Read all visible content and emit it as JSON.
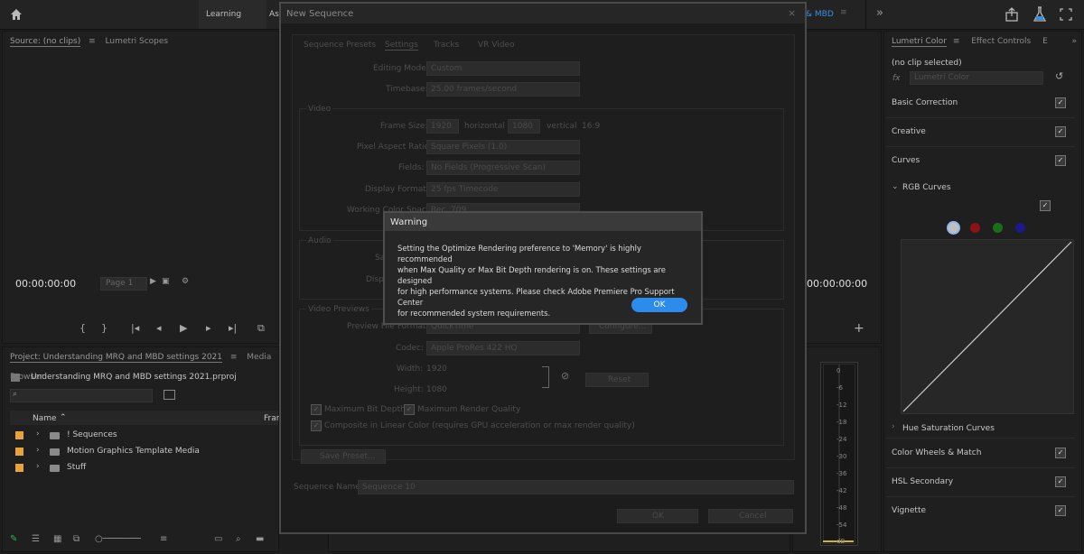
{
  "topbar": {
    "learning": "Learning",
    "assembly_partial": "Ass",
    "workspace_partial": "& MBD",
    "more": "»"
  },
  "source_panel": {
    "tab_source": "Source: (no clips)",
    "tab_lumetri_scopes": "Lumetri Scopes",
    "timecode": "00:00:00:00",
    "page": "Page 1"
  },
  "program_panel": {
    "timecode": "00:00:00:00"
  },
  "project_panel": {
    "tab_project": "Project: Understanding MRQ and MBD settings 2021",
    "tab_media_browser": "Media Browser",
    "project_file": "Understanding MRQ and MBD settings 2021.prproj",
    "col_name": "Name",
    "col_frame_partial": "Fran",
    "items": [
      {
        "label": "! Sequences"
      },
      {
        "label": "Motion Graphics Template Media"
      },
      {
        "label": "Stuff"
      }
    ]
  },
  "lumetri": {
    "tab_lumetri": "Lumetri Color",
    "tab_effect_controls": "Effect Controls",
    "tab_more": "E",
    "no_clip": "(no clip selected)",
    "fx": "fx",
    "effect": "Lumetri Color",
    "sections": {
      "basic": "Basic Correction",
      "creative": "Creative",
      "curves": "Curves",
      "rgb_curves": "RGB Curves",
      "hue_sat": "Hue Saturation Curves",
      "wheels": "Color Wheels & Match",
      "hsl": "HSL Secondary",
      "vignette": "Vignette"
    },
    "curve_colors": [
      "#bfbfbf",
      "#8a1414",
      "#1a6e1a",
      "#1a1a8a"
    ]
  },
  "meter": {
    "ticks": [
      "0",
      "-6",
      "-12",
      "-18",
      "-24",
      "-30",
      "-36",
      "-42",
      "-48",
      "-54",
      "dB"
    ]
  },
  "new_sequence": {
    "title": "New Sequence",
    "close": "×",
    "tabs": [
      "Sequence Presets",
      "Settings",
      "Tracks",
      "VR Video"
    ],
    "editing_mode_label": "Editing Mode:",
    "editing_mode_value": "Custom",
    "timebase_label": "Timebase:",
    "timebase_value": "25.00  frames/second",
    "video_group": "Video",
    "frame_size_label": "Frame Size:",
    "frame_w": "1920",
    "horizontal": "horizontal",
    "frame_h": "1080",
    "vertical": "vertical",
    "aspect": "16:9",
    "par_label": "Pixel Aspect Ratio:",
    "par_value": "Square Pixels (1.0)",
    "fields_label": "Fields:",
    "fields_value": "No Fields (Progressive Scan)",
    "display_format_label": "Display Format:",
    "display_format_value": "25 fps Timecode",
    "working_color_label": "Working Color Space:",
    "working_color_value": "Rec. 709",
    "audio_group": "Audio",
    "audio_sa": "Sa",
    "audio_displ": "Displ",
    "previews_group": "Video Previews",
    "preview_format_label": "Preview File Format:",
    "preview_format_value": "QuickTime",
    "configure": "Configure...",
    "codec_label": "Codec:",
    "codec_value": "Apple ProRes 422 HQ",
    "width_label": "Width:",
    "width_value": "1920",
    "height_label": "Height:",
    "height_value": "1080",
    "reset": "Reset",
    "max_bit_depth": "Maximum Bit Depth",
    "max_render_quality": "Maximum Render Quality",
    "composite_linear": "Composite in Linear Color (requires GPU acceleration or max render quality)",
    "save_preset": "Save Preset...",
    "sequence_name_label": "Sequence Name:",
    "sequence_name_value": "Sequence 10",
    "ok": "OK",
    "cancel": "Cancel"
  },
  "warning": {
    "title": "Warning",
    "line1": "Setting the Optimize Rendering preference to 'Memory' is highly recommended",
    "line2": "when Max Quality or Max Bit Depth rendering is on. These settings are designed",
    "line3": "for high performance systems. Please check Adobe Premiere Pro Support Center",
    "line4": "for recommended system requirements.",
    "ok": "OK",
    "accent": "#2d8ceb"
  }
}
